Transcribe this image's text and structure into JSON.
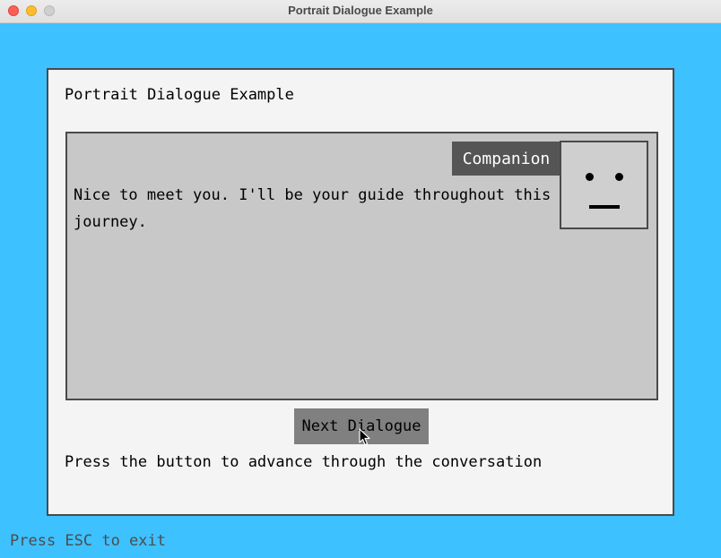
{
  "window": {
    "title": "Portrait Dialogue Example"
  },
  "panel": {
    "title": "Portrait Dialogue Example",
    "hint": "Press the button to advance through the conversation"
  },
  "dialogue": {
    "speaker": "Companion",
    "text": "Nice to meet you. I'll be your guide throughout this journey.",
    "portrait_icon": "neutral-face-icon"
  },
  "controls": {
    "next_label": "Next Dialogue"
  },
  "footer": {
    "exit_hint": "Press ESC to exit"
  },
  "colors": {
    "background": "#3ec1ff",
    "panel": "#f4f4f4",
    "dialogue_box": "#c8c8c8",
    "speaker_tag": "#555555",
    "button": "#808080"
  }
}
